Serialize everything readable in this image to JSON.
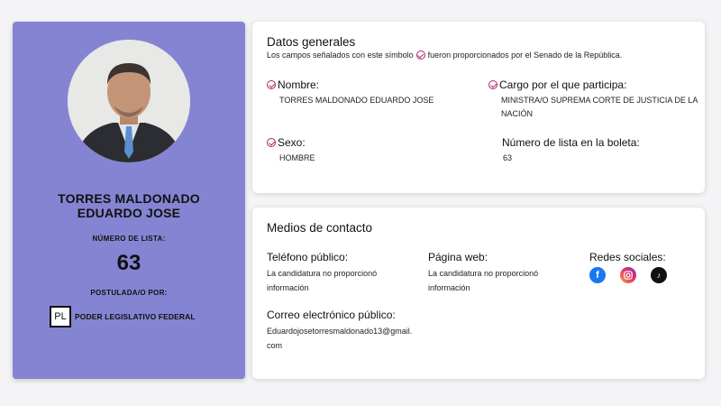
{
  "profile": {
    "name": "TORRES MALDONADO EDUARDO JOSE",
    "number_label": "NÚMERO DE LISTA:",
    "number": "63",
    "postulated_label": "POSTULADA/O POR:",
    "party_logo": "PL",
    "party_name": "PODER LEGISLATIVO FEDERAL"
  },
  "general": {
    "title": "Datos generales",
    "subtitle_before": "Los campos señalados con este símbolo",
    "subtitle_after": "fueron proporcionados por el Senado de la República.",
    "fields": {
      "nombre": {
        "label": "Nombre:",
        "value": "TORRES MALDONADO EDUARDO JOSE"
      },
      "cargo": {
        "label": "Cargo por el que participa:",
        "value": "MINISTRA/O SUPREMA CORTE DE JUSTICIA DE LA NACIÓN"
      },
      "sexo": {
        "label": "Sexo:",
        "value": "HOMBRE"
      },
      "numero": {
        "label": "Número de lista en la boleta:",
        "value": "63"
      }
    }
  },
  "contact": {
    "title": "Medios de contacto",
    "phone": {
      "label": "Teléfono público:",
      "value": "La candidatura no proporcionó información"
    },
    "web": {
      "label": "Página web:",
      "value": "La candidatura no proporcionó información"
    },
    "social": {
      "label": "Redes sociales:",
      "icons": [
        "facebook-icon",
        "instagram-icon",
        "tiktok-icon"
      ]
    },
    "email": {
      "label": "Correo electrónico público:",
      "value": "Eduardojosetorresmaldonado13@gmail.com"
    }
  },
  "colors": {
    "card": "#8584d2",
    "check": "#b0236a",
    "facebook": "#1877f2"
  }
}
